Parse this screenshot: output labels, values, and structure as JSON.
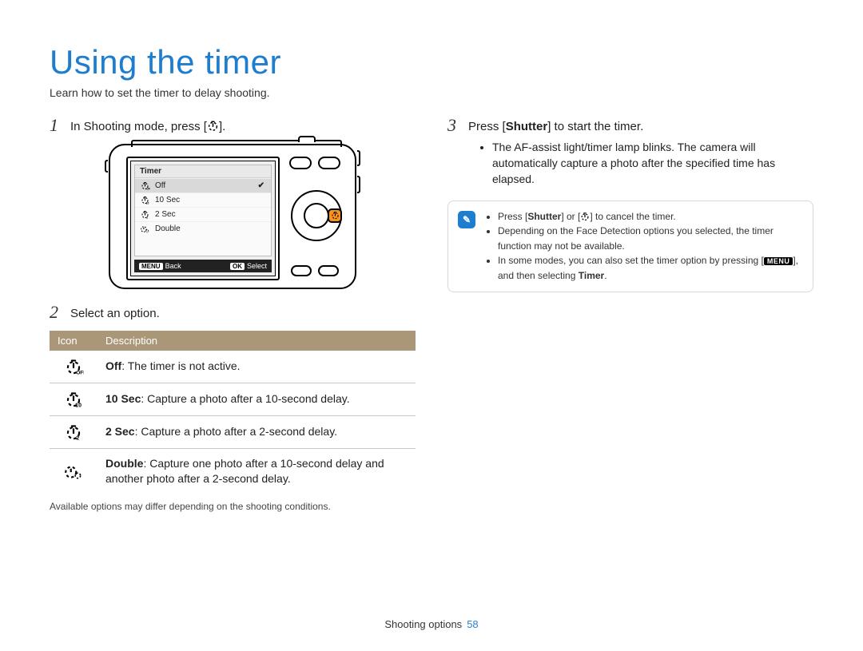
{
  "title": "Using the timer",
  "subtitle": "Learn how to set the timer to delay shooting.",
  "step1": {
    "num": "1",
    "text_a": "In Shooting mode, press [",
    "text_b": "]."
  },
  "camera_menu": {
    "title": "Timer",
    "items": [
      "Off",
      "10 Sec",
      "2 Sec",
      "Double"
    ],
    "back_key": "MENU",
    "back": "Back",
    "select_key": "OK",
    "select": "Select"
  },
  "step2": {
    "num": "2",
    "text": "Select an option."
  },
  "table": {
    "h_icon": "Icon",
    "h_desc": "Description",
    "rows": [
      {
        "label": "Off",
        "desc": ": The timer is not active."
      },
      {
        "label": "10 Sec",
        "desc": ": Capture a photo after a 10-second delay."
      },
      {
        "label": "2 Sec",
        "desc": ": Capture a photo after a 2-second delay."
      },
      {
        "label": "Double",
        "desc": ": Capture one photo after a 10-second delay and another photo after a 2-second delay."
      }
    ]
  },
  "footnote": "Available options may differ depending on the shooting conditions.",
  "step3": {
    "num": "3",
    "text_a": "Press [",
    "bold": "Shutter",
    "text_b": "] to start the timer.",
    "bullet": "The AF-assist light/timer lamp blinks. The camera will automatically capture a photo after the specified time has elapsed."
  },
  "note": {
    "n1a": "Press [",
    "n1bold": "Shutter",
    "n1b": "] or [",
    "n1c": "] to cancel the timer.",
    "n2": "Depending on the Face Detection options you selected, the timer function may not be available.",
    "n3a": "In some modes, you can also set the timer option by pressing [",
    "n3b": "], and then selecting ",
    "n3bold": "Timer",
    "n3c": "."
  },
  "footer": {
    "section": "Shooting options",
    "page": "58"
  }
}
